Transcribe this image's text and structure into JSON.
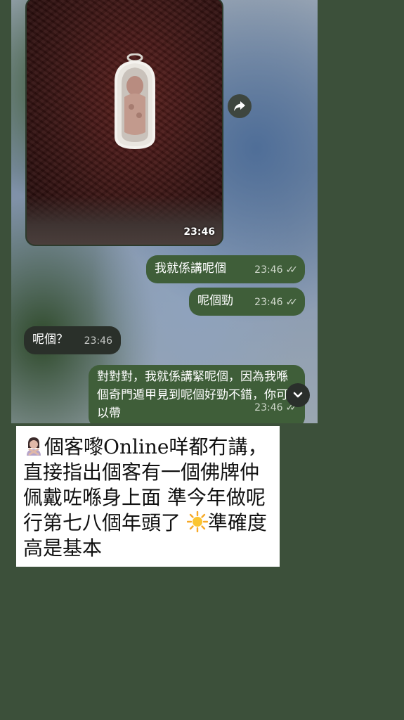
{
  "chat": {
    "photo_message": {
      "time": "23:46"
    },
    "messages": [
      {
        "direction": "out",
        "text": "我就係講呢個",
        "time": "23:46"
      },
      {
        "direction": "out",
        "text": "呢個勁",
        "time": "23:46"
      },
      {
        "direction": "in",
        "text": "呢個？",
        "time": "23:46"
      },
      {
        "direction": "out",
        "text": "對對對，我就係講緊呢個，因為我喺個奇門遁甲見到呢個好勁不錯，你可以帶",
        "time": "23:46"
      }
    ]
  },
  "caption": {
    "text": "個客嚟Online咩都冇講，直接指出個客有一個佛牌仲佩戴咗喺身上面 準今年做呢行第七八個年頭了 ",
    "text_end": "準確度高是基本",
    "emoji_start": "person-gesturing-no",
    "emoji_mid": "sun"
  },
  "icons": {
    "share": "share-arrow-icon",
    "scroll": "chevron-down-icon",
    "read": "double-check-icon"
  },
  "colors": {
    "background": "#3c503a",
    "outgoing_bubble": "#3f5e39",
    "incoming_bubble": "#2a302a"
  }
}
